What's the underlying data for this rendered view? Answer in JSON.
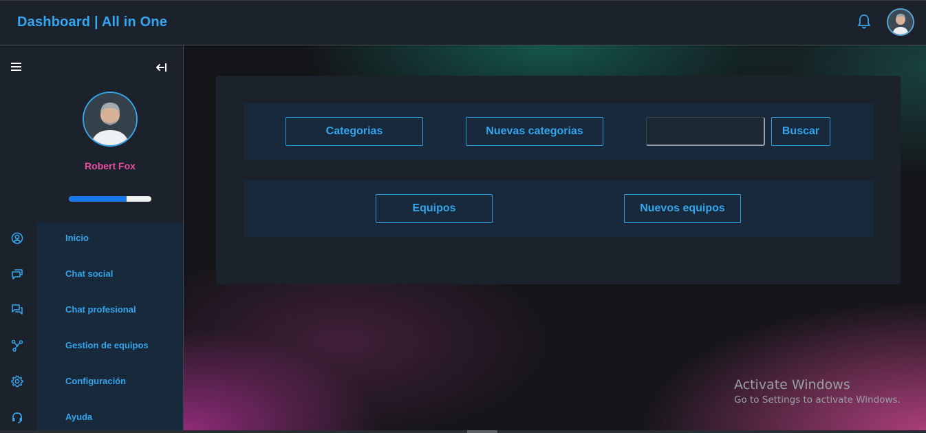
{
  "header": {
    "title": "Dashboard | All in One",
    "notification_icon": "bell-icon",
    "avatar_alt": "user-avatar"
  },
  "sidebar": {
    "menu_icon": "hamburger-menu-icon",
    "collapse_icon": "arrow-left-bar-icon",
    "user": {
      "name": "Robert Fox",
      "progress": 0.7
    },
    "items": [
      {
        "label": "Inicio",
        "icon": "user-circle-icon"
      },
      {
        "label": "Chat social",
        "icon": "chat-bubbles-icon"
      },
      {
        "label": "Chat profesional",
        "icon": "chat-message-icon"
      },
      {
        "label": "Gestion de equipos",
        "icon": "network-nodes-icon"
      },
      {
        "label": "Configuración",
        "icon": "gear-icon"
      },
      {
        "label": "Ayuda",
        "icon": "headset-icon"
      }
    ]
  },
  "main": {
    "categories_row": {
      "categories_label": "Categorias",
      "new_categories_label": "Nuevas categorias",
      "search_value": "",
      "search_button_label": "Buscar"
    },
    "teams_row": {
      "teams_label": "Equipos",
      "new_teams_label": "Nuevos equipos"
    }
  },
  "watermark": {
    "title": "Activate Windows",
    "subtitle": "Go to Settings to activate Windows."
  },
  "colors": {
    "accent": "#35a6ee",
    "name": "#ea4fa0",
    "progress": "#1677e8"
  }
}
